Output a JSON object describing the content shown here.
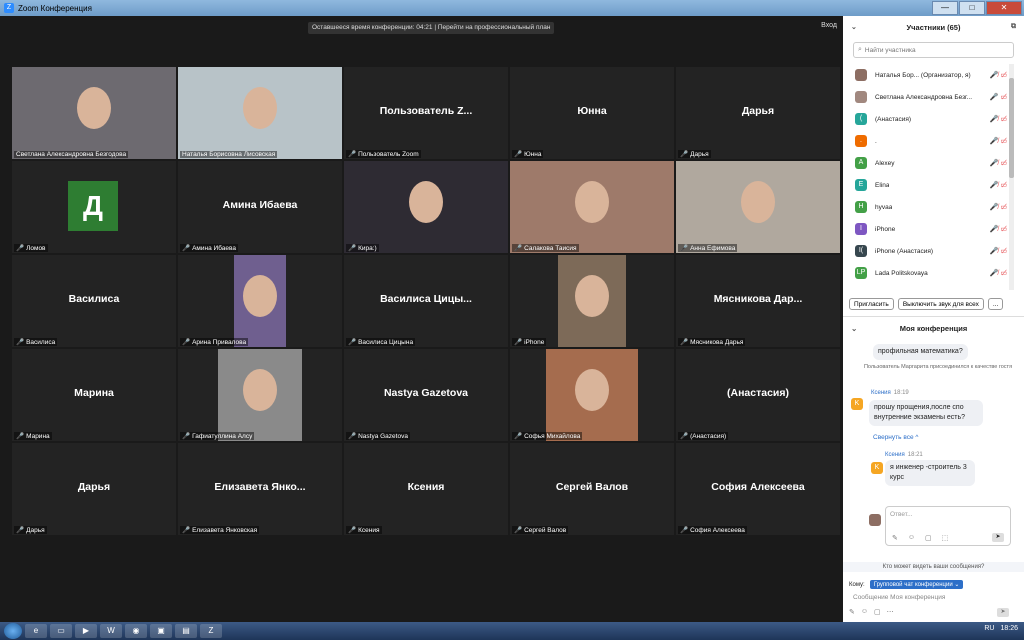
{
  "window": {
    "title": "Zoom Конференция",
    "logo": "Z"
  },
  "window_buttons": [
    "—",
    "□",
    "✕"
  ],
  "meeting": {
    "timer_text": "Оставшееся время конференции: 04:21 | Перейти на профессиональный план",
    "exit_label": "Вход"
  },
  "tiles": [
    {
      "big": "",
      "label": "Светлана Александровна Безгодова",
      "muted": false,
      "video": true
    },
    {
      "big": "",
      "label": "Наталья Борисовна Лисовская",
      "muted": false,
      "video": true
    },
    {
      "big": "Пользователь Z...",
      "label": "Пользователь Zoom",
      "muted": true,
      "video": false
    },
    {
      "big": "Юнна",
      "label": "Юнна",
      "muted": true,
      "video": false
    },
    {
      "big": "Дарья",
      "label": "Дарья",
      "muted": true,
      "video": false
    },
    {
      "big": "Д",
      "label": "Ломов",
      "muted": true,
      "video": false
    },
    {
      "big": "Амина Ибаева",
      "label": "Амина Ибаева",
      "muted": true,
      "video": false
    },
    {
      "big": "",
      "label": "Кира:)",
      "muted": true,
      "video": true
    },
    {
      "big": "",
      "label": "Салакова Таисия",
      "muted": true,
      "video": true
    },
    {
      "big": "",
      "label": "Анна Ефимова",
      "muted": true,
      "video": true
    },
    {
      "big": "Василиса",
      "label": "Василиса",
      "muted": true,
      "video": false
    },
    {
      "big": "",
      "label": "Арина Привалова",
      "muted": true,
      "video": true
    },
    {
      "big": "Василиса Цицы...",
      "label": "Василиса Цицына",
      "muted": true,
      "video": false
    },
    {
      "big": "",
      "label": "iPhone",
      "muted": true,
      "video": true
    },
    {
      "big": "Мясникова Дар...",
      "label": "Мясникова Дарья",
      "muted": true,
      "video": false
    },
    {
      "big": "Марина",
      "label": "Марина",
      "muted": true,
      "video": false
    },
    {
      "big": "",
      "label": "Гафиатуллина Алсу",
      "muted": true,
      "video": true
    },
    {
      "big": "Nastya Gazetova",
      "label": "Nastya Gazetova",
      "muted": true,
      "video": false
    },
    {
      "big": "",
      "label": "Софья Михайлова",
      "muted": true,
      "video": true
    },
    {
      "big": "(Анастасия)",
      "label": "(Анастасия)",
      "muted": true,
      "video": false
    },
    {
      "big": "Дарья",
      "label": "Дарья",
      "muted": true,
      "video": false
    },
    {
      "big": "Елизавета Янко...",
      "label": "Елизавета Янковская",
      "muted": true,
      "video": false
    },
    {
      "big": "Ксения",
      "label": "Ксения",
      "muted": true,
      "video": false
    },
    {
      "big": "Сергей Валов",
      "label": "Сергей Валов",
      "muted": true,
      "video": false
    },
    {
      "big": "София Алексеева",
      "label": "София Алексеева",
      "muted": true,
      "video": false
    }
  ],
  "participants": {
    "title": "Участники (65)",
    "search_placeholder": "Найти участника",
    "items": [
      {
        "initial": "",
        "name": "Наталья Бор... (Организатор, я)",
        "color": "#8d6e63",
        "icons": "🎤̸ ▭̸"
      },
      {
        "initial": "",
        "name": "Светлана Александровна Безг...",
        "color": "#a1887f",
        "icons": "🎤 ▭̸"
      },
      {
        "initial": "(",
        "name": "(Анастасия)",
        "color": "#26a69a",
        "icons": "🎤̸ ▭̸"
      },
      {
        "initial": ".",
        "name": ".",
        "color": "#ef6c00",
        "icons": "🎤̸ ▭̸"
      },
      {
        "initial": "A",
        "name": "Alexey",
        "color": "#43a047",
        "icons": "🎤̸ ▭̸"
      },
      {
        "initial": "E",
        "name": "Elina",
        "color": "#26a69a",
        "icons": "🎤̸ ▭̸"
      },
      {
        "initial": "H",
        "name": "hyvaa",
        "color": "#43a047",
        "icons": "🎤̸ ▭̸"
      },
      {
        "initial": "I",
        "name": "iPhone",
        "color": "#7e57c2",
        "icons": "🎤̸ ▭̸"
      },
      {
        "initial": "I(",
        "name": "iPhone (Анастасия)",
        "color": "#37474f",
        "icons": "🎤̸ ▭̸"
      },
      {
        "initial": "LP",
        "name": "Lada Politskovaya",
        "color": "#43a047",
        "icons": "🎤̸ ▭̸"
      }
    ],
    "invite_label": "Пригласить",
    "mute_all_label": "Выключить звук для всех",
    "more_label": "..."
  },
  "chat": {
    "title": "Моя конференция",
    "msg1": "профильная математика?",
    "system": "Пользователь Маргарита присоединился к качестве гостя",
    "sender1": "Ксения",
    "time1": "18:19",
    "msg2": "прошу прощения,после спо внутренние экзамены есть?",
    "collapse_label": "Свернуть все ^",
    "sender2": "Ксения",
    "time2": "18:21",
    "msg3": "я инженер -строитель 3 курс",
    "reply_placeholder": "Ответ...",
    "who_can_see": "Кто может видеть ваши сообщения?",
    "to_label": "Кому:",
    "to_value": "Групповой чат конференции ⌄",
    "input_placeholder": "Сообщение Моя конференция"
  },
  "taskbar": {
    "lang": "RU",
    "time": "18:26"
  },
  "colors": {
    "accent": "#2d8cff",
    "muted_red": "#e5484d",
    "active_border": "#f5e342"
  }
}
